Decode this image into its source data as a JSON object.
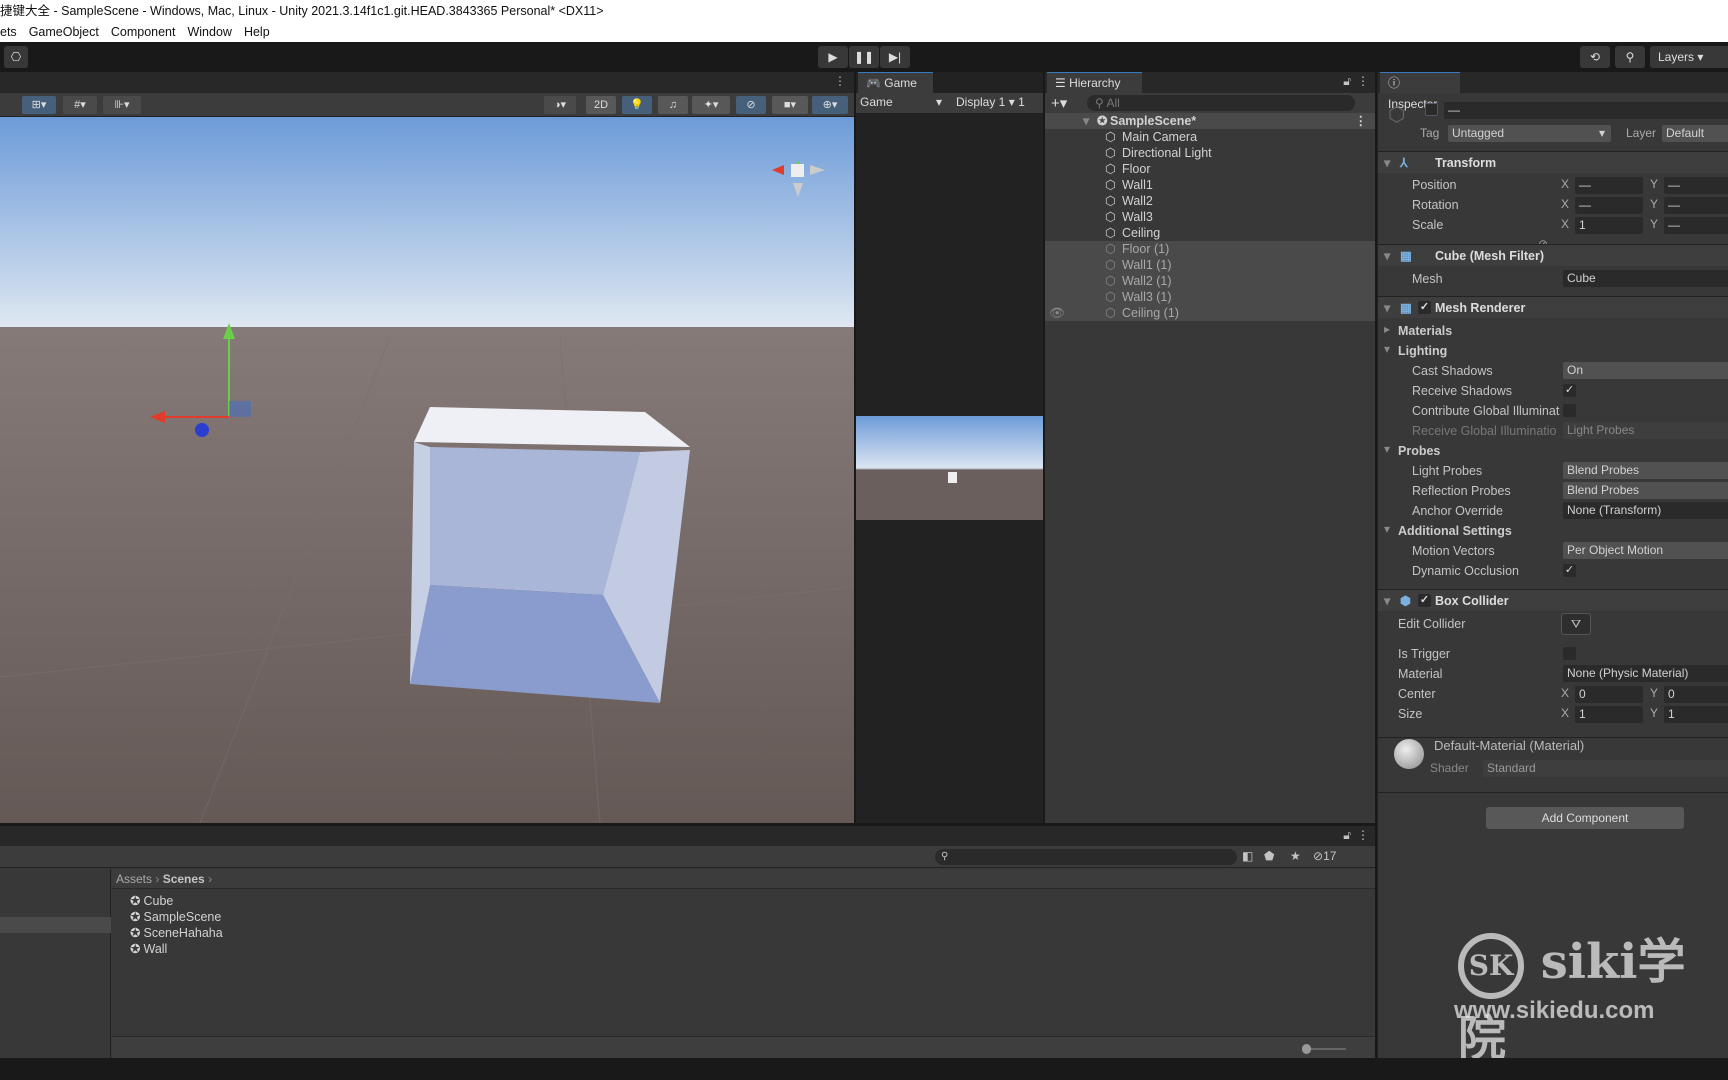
{
  "window": {
    "title": "捷键大全 - SampleScene - Windows, Mac, Linux - Unity 2021.3.14f1c1.git.HEAD.3843365 Personal* <DX11>"
  },
  "menu": [
    "ets",
    "GameObject",
    "Component",
    "Window",
    "Help"
  ],
  "toolbar": {
    "layers_label": "Layers"
  },
  "scene": {
    "btn_2d": "2D"
  },
  "game": {
    "tab": "Game",
    "view_select": "Game",
    "display_select": "Display 1",
    "scale_fragment": "1"
  },
  "hierarchy": {
    "tab": "Hierarchy",
    "search_placeholder": "All",
    "scene": "SampleScene*",
    "items": [
      {
        "name": "Main Camera",
        "dim": false
      },
      {
        "name": "Directional Light",
        "dim": false
      },
      {
        "name": "Floor",
        "dim": false
      },
      {
        "name": "Wall1",
        "dim": false
      },
      {
        "name": "Wall2",
        "dim": false
      },
      {
        "name": "Wall3",
        "dim": false
      },
      {
        "name": "Ceiling",
        "dim": false
      },
      {
        "name": "Floor (1)",
        "dim": true
      },
      {
        "name": "Wall1 (1)",
        "dim": true
      },
      {
        "name": "Wall2 (1)",
        "dim": true
      },
      {
        "name": "Wall3 (1)",
        "dim": true
      },
      {
        "name": "Ceiling (1)",
        "dim": true
      }
    ]
  },
  "inspector": {
    "tab": "Inspector",
    "name_value": "—",
    "tag_label": "Tag",
    "tag_value": "Untagged",
    "layer_label": "Layer",
    "layer_value": "Default",
    "transform": {
      "title": "Transform",
      "rows": [
        {
          "label": "Position",
          "x": "—",
          "y": "—"
        },
        {
          "label": "Rotation",
          "x": "—",
          "y": "—"
        },
        {
          "label": "Scale",
          "x": "1",
          "y": "—"
        }
      ]
    },
    "mesh_filter": {
      "title": "Cube (Mesh Filter)",
      "mesh_label": "Mesh",
      "mesh_value": "Cube"
    },
    "mesh_renderer": {
      "title": "Mesh Renderer",
      "enabled": true,
      "materials": "Materials",
      "lighting": "Lighting",
      "cast_shadows": {
        "label": "Cast Shadows",
        "value": "On"
      },
      "receive_shadows": {
        "label": "Receive Shadows",
        "checked": true
      },
      "contribute_gi": {
        "label": "Contribute Global Illuminat",
        "checked": false
      },
      "receive_gi": {
        "label": "Receive Global Illuminatio",
        "value": "Light Probes"
      },
      "probes": "Probes",
      "light_probes": {
        "label": "Light Probes",
        "value": "Blend Probes"
      },
      "reflection_probes": {
        "label": "Reflection Probes",
        "value": "Blend Probes"
      },
      "anchor_override": {
        "label": "Anchor Override",
        "value": "None (Transform)"
      },
      "additional": "Additional Settings",
      "motion_vectors": {
        "label": "Motion Vectors",
        "value": "Per Object Motion"
      },
      "dynamic_occlusion": {
        "label": "Dynamic Occlusion",
        "checked": true
      }
    },
    "box_collider": {
      "title": "Box Collider",
      "enabled": true,
      "edit_label": "Edit Collider",
      "trigger_label": "Is Trigger",
      "trigger_checked": false,
      "material_label": "Material",
      "material_value": "None (Physic Material)",
      "center": {
        "label": "Center",
        "x": "0",
        "y": "0"
      },
      "size": {
        "label": "Size",
        "x": "1",
        "y": "1"
      }
    },
    "material": {
      "name": "Default-Material (Material)",
      "shader_label": "Shader",
      "shader_value": "Standard"
    },
    "add_component": "Add Component"
  },
  "project": {
    "breadcrumb": [
      "Assets",
      "Scenes"
    ],
    "hidden_count": "17",
    "items": [
      "Cube",
      "SampleScene",
      "SceneHahaha",
      "Wall"
    ]
  },
  "watermark": {
    "text": "siki学院",
    "url": "www.sikiedu.com"
  },
  "colors": {
    "accent": "#3a79bb",
    "panel": "#383838",
    "sky_top": "#6d9bd8",
    "ground": "#6b5f5d"
  }
}
